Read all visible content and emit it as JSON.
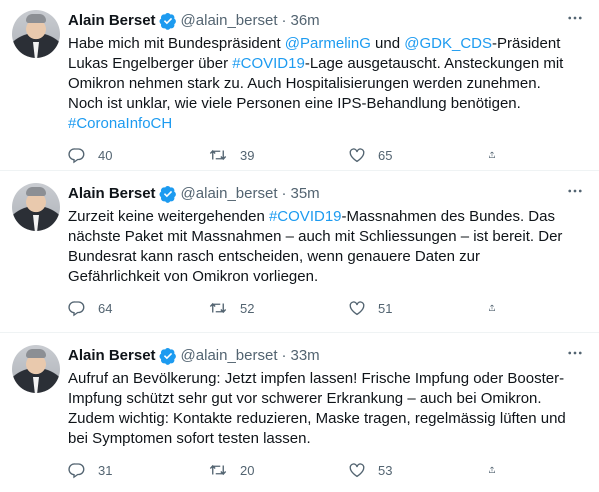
{
  "tweets": [
    {
      "name": "Alain Berset",
      "handle": "@alain_berset",
      "time": "36m",
      "text_parts": [
        {
          "t": "Habe mich mit Bundespräsident ",
          "link": false
        },
        {
          "t": "@ParmelinG",
          "link": true
        },
        {
          "t": " und ",
          "link": false
        },
        {
          "t": "@GDK_CDS",
          "link": true
        },
        {
          "t": "-Präsident Lukas Engelberger über ",
          "link": false
        },
        {
          "t": "#COVID19",
          "link": true
        },
        {
          "t": "-Lage ausgetauscht. Ansteckungen mit Omikron nehmen stark zu. Auch Hospitalisierungen werden zunehmen. Noch ist unklar, wie viele Personen eine IPS-Behandlung benötigen. ",
          "link": false
        },
        {
          "t": "#CoronaInfoCH",
          "link": true
        }
      ],
      "replies": "40",
      "retweets": "39",
      "likes": "65"
    },
    {
      "name": "Alain Berset",
      "handle": "@alain_berset",
      "time": "35m",
      "text_parts": [
        {
          "t": "Zurzeit keine weitergehenden ",
          "link": false
        },
        {
          "t": "#COVID19",
          "link": true
        },
        {
          "t": "-Massnahmen des Bundes. Das nächste Paket mit Massnahmen – auch mit Schliessungen – ist bereit. Der Bundesrat kann rasch entscheiden, wenn genauere Daten zur Gefährlichkeit von Omikron vorliegen.",
          "link": false
        }
      ],
      "replies": "64",
      "retweets": "52",
      "likes": "51"
    },
    {
      "name": "Alain Berset",
      "handle": "@alain_berset",
      "time": "33m",
      "text_parts": [
        {
          "t": "Aufruf an Bevölkerung: Jetzt impfen lassen! Frische Impfung oder Booster-Impfung schützt sehr gut vor schwerer Erkrankung – auch bei Omikron. Zudem wichtig: Kontakte reduzieren, Maske tragen, regelmässig lüften und bei Symptomen sofort testen lassen.",
          "link": false
        }
      ],
      "replies": "31",
      "retweets": "20",
      "likes": "53"
    }
  ],
  "separator": "·",
  "icons": {
    "verified": "verified-badge-icon",
    "more": "more-options-icon",
    "reply": "reply-icon",
    "retweet": "retweet-icon",
    "like": "like-icon",
    "share": "share-icon"
  },
  "colors": {
    "link": "#1d9bf0",
    "verified": "#1d9bf0",
    "secondary": "#536471",
    "text": "#0f1419"
  }
}
